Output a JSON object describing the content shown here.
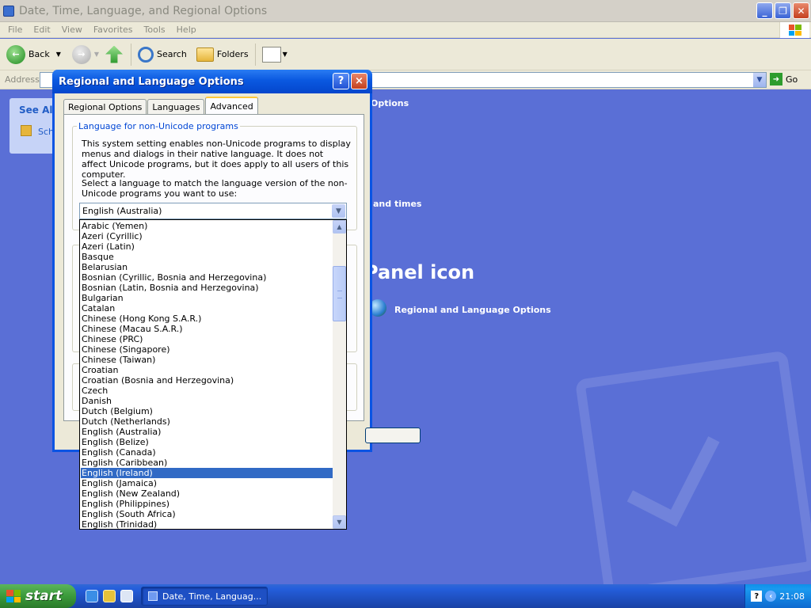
{
  "window": {
    "title": "Date, Time, Language, and Regional Options",
    "menu": [
      "File",
      "Edit",
      "View",
      "Favorites",
      "Tools",
      "Help"
    ],
    "toolbar": {
      "back_label": "Back",
      "search_label": "Search",
      "folders_label": "Folders"
    },
    "address": {
      "label": "Address",
      "go_label": "Go"
    }
  },
  "content": {
    "see_also_label": "See Als",
    "sch_label": "Sch",
    "options_text": "Options",
    "and_times_text": "and times",
    "panel_icon_text": "Panel icon",
    "rlo_link": "Regional and Language Options"
  },
  "dialog": {
    "title": "Regional and Language Options",
    "help_glyph": "?",
    "close_glyph": "×",
    "tabs": [
      {
        "label": "Regional Options",
        "active": false
      },
      {
        "label": "Languages",
        "active": false
      },
      {
        "label": "Advanced",
        "active": true
      }
    ],
    "group_label": "Language for non-Unicode programs",
    "paragraph1": "This system setting enables non-Unicode programs to display menus and dialogs in their native language. It does not affect Unicode programs, but it does apply to all users of this computer.",
    "paragraph2": "Select a language to match the language version of the non-Unicode programs you want to use:",
    "combo_value": "English (Australia)",
    "dropdown_items": [
      "Arabic (Yemen)",
      "Azeri (Cyrillic)",
      "Azeri (Latin)",
      "Basque",
      "Belarusian",
      "Bosnian (Cyrillic, Bosnia and Herzegovina)",
      "Bosnian (Latin, Bosnia and Herzegovina)",
      "Bulgarian",
      "Catalan",
      "Chinese (Hong Kong S.A.R.)",
      "Chinese (Macau S.A.R.)",
      "Chinese (PRC)",
      "Chinese (Singapore)",
      "Chinese (Taiwan)",
      "Croatian",
      "Croatian (Bosnia and Herzegovina)",
      "Czech",
      "Danish",
      "Dutch (Belgium)",
      "Dutch (Netherlands)",
      "English (Australia)",
      "English (Belize)",
      "English (Canada)",
      "English (Caribbean)",
      "English (Ireland)",
      "English (Jamaica)",
      "English (New Zealand)",
      "English (Philippines)",
      "English (South Africa)",
      "English (Trinidad)"
    ],
    "selected_item": "English (Ireland)"
  },
  "taskbar": {
    "start_label": "start",
    "task_label": "Date, Time, Languag...",
    "clock": "21:08"
  },
  "colors": {
    "desktop_blue": "#5a6fd6",
    "dialog_frame": "#0a54e3",
    "selection": "#316ac5",
    "taskbar": "#245edb",
    "start_green": "#3b9a3b"
  }
}
